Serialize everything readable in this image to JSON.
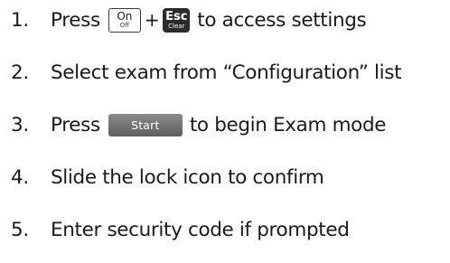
{
  "steps": [
    {
      "number": "1.",
      "text_before": "Press",
      "key_on_label": "On",
      "key_on_sublabel": "Off",
      "plus": "+",
      "key_esc_label": "Esc",
      "key_esc_sublabel": "Clear",
      "text_after": "to access settings"
    },
    {
      "number": "2.",
      "text": "Select exam from “Configuration” list"
    },
    {
      "number": "3.",
      "text_before": "Press",
      "key_start_label": "Start",
      "text_after": "to begin Exam mode"
    },
    {
      "number": "4.",
      "text": "Slide the lock icon to confirm"
    },
    {
      "number": "5.",
      "text": "Enter security code if prompted"
    }
  ],
  "colors": {
    "text": "#1a1a1a",
    "esc_key": "#2b2b2b",
    "start_key": "#707070"
  }
}
